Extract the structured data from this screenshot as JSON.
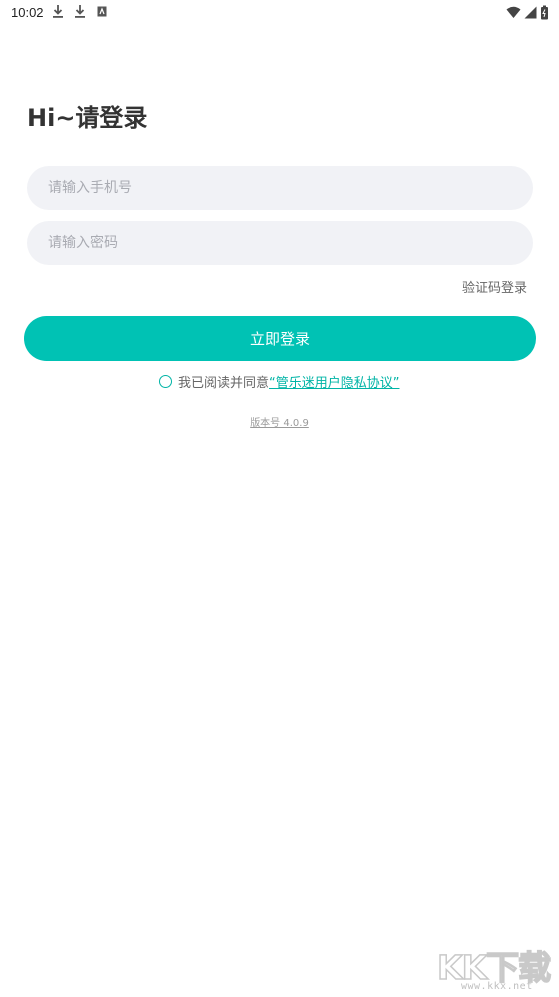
{
  "status_bar": {
    "time": "10:02",
    "left_icons": [
      "download-icon",
      "download-icon",
      "app-notification-icon"
    ],
    "right_icons": [
      "wifi-icon",
      "cellular-signal-icon",
      "battery-icon"
    ]
  },
  "header": {
    "title": "Hi~请登录"
  },
  "form": {
    "phone_placeholder": "请输入手机号",
    "password_placeholder": "请输入密码",
    "sms_login_label": "验证码登录",
    "login_button_label": "立即登录"
  },
  "agreement": {
    "prefix": "我已阅读并同意",
    "link_text": "“管乐迷用户隐私协议”",
    "checked": false
  },
  "footer": {
    "version": "版本号 4.0.9"
  },
  "watermark": {
    "text": "KK下载",
    "url": "www.kkx.net"
  },
  "colors": {
    "accent": "#00c2b4",
    "input_bg": "#f1f2f6",
    "title": "#333333"
  }
}
